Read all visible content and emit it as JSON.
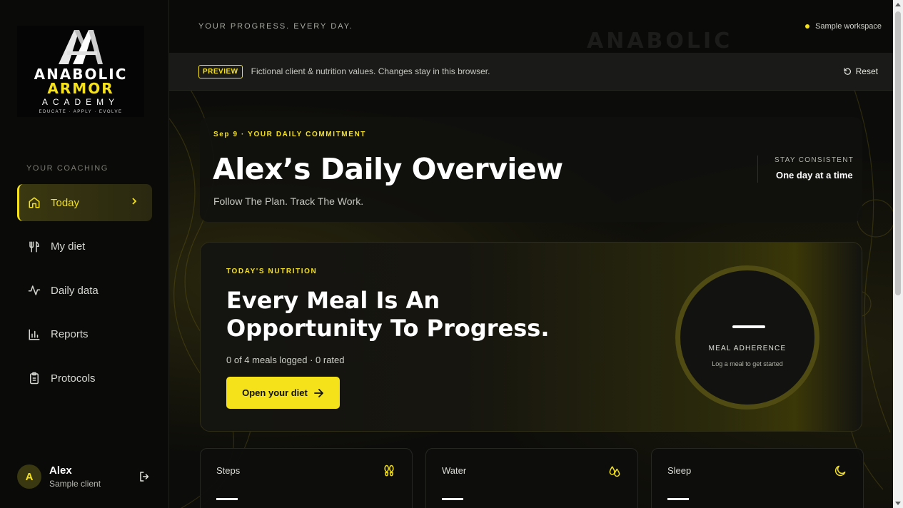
{
  "brand": {
    "line1": "ANABOLIC",
    "line2": "ARMOR",
    "line3": "ACADEMY",
    "line4": "EDUCATE · APPLY · EVOLVE",
    "accent_color": "#f5e21a"
  },
  "sidebar": {
    "section_label": "YOUR COACHING",
    "items": [
      {
        "label": "Today",
        "icon": "home-icon",
        "active": true
      },
      {
        "label": "My diet",
        "icon": "utensils-icon"
      },
      {
        "label": "Daily data",
        "icon": "activity-icon"
      },
      {
        "label": "Reports",
        "icon": "bar-chart-icon"
      },
      {
        "label": "Protocols",
        "icon": "clipboard-icon"
      }
    ],
    "user": {
      "initial": "A",
      "name": "Alex",
      "role": "Sample client"
    }
  },
  "topbar": {
    "tagline": "YOUR PROGRESS. EVERY DAY.",
    "watermark": "ANABOLIC",
    "workspace": "Sample workspace"
  },
  "preview": {
    "badge": "PREVIEW",
    "text": "Fictional client & nutrition values. Changes stay in this browser.",
    "reset_label": "Reset"
  },
  "overview": {
    "date_line": "Sep 9 · YOUR DAILY COMMITMENT",
    "title": "Alex’s Daily Overview",
    "subtitle": "Follow The Plan. Track The Work.",
    "stay_label": "STAY CONSISTENT",
    "stay_value": "One day at a time"
  },
  "nutrition": {
    "label": "TODAY'S NUTRITION",
    "title": "Every Meal Is An Opportunity To Progress.",
    "meta": "0 of 4 meals logged · 0 rated",
    "button_label": "Open your diet",
    "ring_label": "MEAL ADHERENCE",
    "ring_sub": "Log a meal to get started"
  },
  "stats": [
    {
      "label": "Steps",
      "icon": "footprints-icon"
    },
    {
      "label": "Water",
      "icon": "droplets-icon"
    },
    {
      "label": "Sleep",
      "icon": "moon-icon"
    }
  ]
}
